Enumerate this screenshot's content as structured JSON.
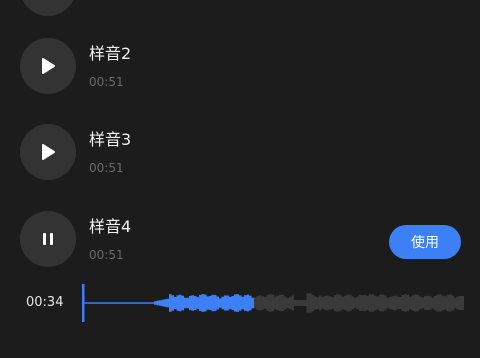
{
  "samples": [
    {
      "title": "样音2",
      "duration": "00:51",
      "icon": "play-icon"
    },
    {
      "title": "样音3",
      "duration": "00:51",
      "icon": "play-icon"
    },
    {
      "title": "样音4",
      "duration": "00:51",
      "icon": "pause-icon",
      "action_label": "使用"
    }
  ],
  "player": {
    "current_time": "00:34",
    "progress": 0.44,
    "colors": {
      "played": "#3d7ff5",
      "unplayed": "#3a3a3a"
    }
  },
  "colors": {
    "accent": "#3d7ff5",
    "background": "#1c1c1c",
    "button": "#333333"
  }
}
